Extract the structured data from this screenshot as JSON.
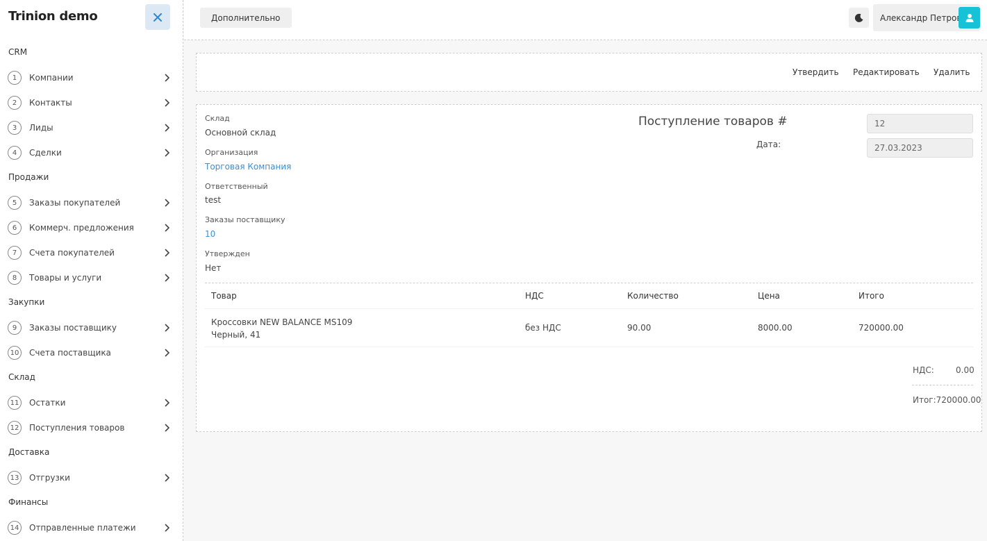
{
  "sidebar": {
    "brand": "Trinion demo",
    "sections": [
      {
        "title": "CRM",
        "items": [
          {
            "num": "1",
            "label": "Компании"
          },
          {
            "num": "2",
            "label": "Контакты"
          },
          {
            "num": "3",
            "label": "Лиды"
          },
          {
            "num": "4",
            "label": "Сделки"
          }
        ]
      },
      {
        "title": "Продажи",
        "items": [
          {
            "num": "5",
            "label": "Заказы покупателей"
          },
          {
            "num": "6",
            "label": "Коммерч. предложения"
          },
          {
            "num": "7",
            "label": "Счета покупателей"
          },
          {
            "num": "8",
            "label": "Товары и услуги"
          }
        ]
      },
      {
        "title": "Закупки",
        "items": [
          {
            "num": "9",
            "label": "Заказы поставщику"
          },
          {
            "num": "10",
            "label": "Счета поставщика"
          }
        ]
      },
      {
        "title": "Склад",
        "items": [
          {
            "num": "11",
            "label": "Остатки"
          },
          {
            "num": "12",
            "label": "Поступления товаров"
          }
        ]
      },
      {
        "title": "Доставка",
        "items": [
          {
            "num": "13",
            "label": "Отгрузки"
          }
        ]
      },
      {
        "title": "Финансы",
        "items": [
          {
            "num": "14",
            "label": "Отправленные платежи"
          }
        ]
      }
    ]
  },
  "topbar": {
    "extra_label": "Дополнительно",
    "user_name": "Александр Петров"
  },
  "actions": {
    "approve": "Утвердить",
    "edit": "Редактировать",
    "delete": "Удалить"
  },
  "document": {
    "title": "Поступление товаров #",
    "number": "12",
    "date_label": "Дата:",
    "date": "27.03.2023",
    "fields": {
      "warehouse_label": "Склад",
      "warehouse": "Основной склад",
      "org_label": "Организация",
      "org": "Торговая Компания",
      "responsible_label": "Ответственный",
      "responsible": "test",
      "supplier_orders_label": "Заказы поставщику",
      "supplier_orders": "10",
      "approved_label": "Утвержден",
      "approved": "Нет"
    }
  },
  "table": {
    "headers": {
      "product": "Товар",
      "vat": "НДС",
      "qty": "Количество",
      "price": "Цена",
      "total": "Итого"
    },
    "rows": [
      {
        "product_line1": "Кроссовки NEW BALANCE MS109",
        "product_line2": "Черный, 41",
        "vat": "без НДС",
        "qty": "90.00",
        "price": "8000.00",
        "total": "720000.00"
      }
    ]
  },
  "summary": {
    "vat_label": "НДС:",
    "vat_value": "0.00",
    "total_label": "Итог:",
    "total_value": "720000.00"
  },
  "colors": {
    "accent": "#3b8fd6",
    "avatar_bg": "#17c2d6",
    "close_bg": "#dce9f5"
  }
}
